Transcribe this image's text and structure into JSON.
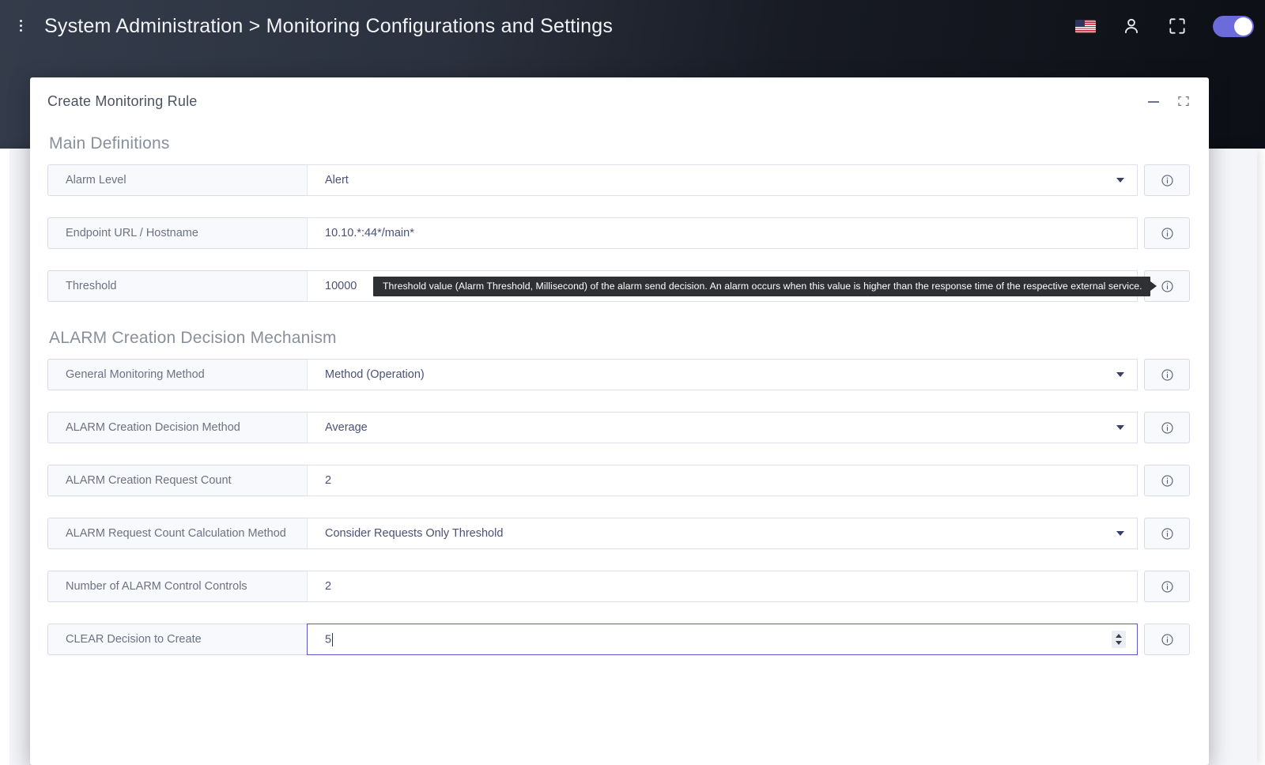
{
  "topbar": {
    "menu_icon": "list-menu-icon",
    "breadcrumb": "System Administration > Monitoring Configurations and Settings",
    "flag_icon": "us-flag-icon",
    "person_icon": "person-icon",
    "fullscreen_icon": "fullscreen-icon",
    "toggle_state": "on",
    "accent_color": "#6b6bdb",
    "background_color": "#2b313e"
  },
  "dialog": {
    "title": "Create Monitoring Rule",
    "minimize_label": "minimize-icon",
    "maximize_label": "maximize-icon",
    "sections": [
      {
        "title": "Main Definitions",
        "fields": [
          {
            "label": "Alarm Level",
            "value": "Alert",
            "control": "select"
          },
          {
            "label": "Endpoint URL / Hostname",
            "value": "10.10.*:44*/main*",
            "control": "text"
          },
          {
            "label": "Threshold",
            "value": "10000",
            "control": "text",
            "tooltip": "Threshold value (Alarm Threshold, Millisecond) of the alarm send decision. An alarm occurs when this value is higher than the response time of the respective external service."
          }
        ]
      },
      {
        "title": "ALARM Creation Decision Mechanism",
        "fields": [
          {
            "label": "General Monitoring Method",
            "value": "Method (Operation)",
            "control": "select"
          },
          {
            "label": "ALARM Creation Decision Method",
            "value": "Average",
            "control": "select"
          },
          {
            "label": "ALARM Creation Request Count",
            "value": "2",
            "control": "text"
          },
          {
            "label": "ALARM Request Count Calculation Method",
            "value": "Consider Requests Only Threshold",
            "control": "select"
          },
          {
            "label": "Number of ALARM Control Controls",
            "value": "2",
            "control": "text"
          },
          {
            "label": "CLEAR Decision to Create",
            "value": "5",
            "control": "number",
            "focused": true
          }
        ]
      }
    ],
    "info_icon": "info-icon"
  }
}
